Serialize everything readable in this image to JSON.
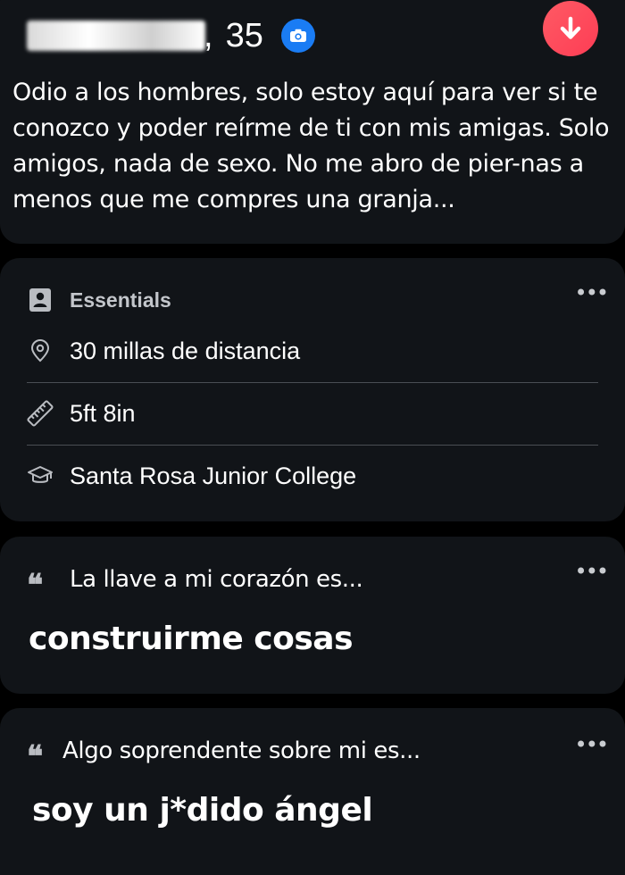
{
  "profile": {
    "name_suffix": ",",
    "age": "35",
    "bio": "Odio a los hombres, solo estoy aquí para ver si te conozco y poder reírme de ti con mis amigas. Solo amigos, nada de sexo. No me abro de pier-nas a menos que me compres una granja..."
  },
  "icons": {
    "verified_badge": "camera-icon",
    "action": "arrow-down-icon",
    "essentials": "id-badge-icon",
    "distance": "location-pin-icon",
    "height": "ruler-icon",
    "school": "graduation-cap-icon",
    "more": "more-dots-icon",
    "quote": "quote-icon"
  },
  "colors": {
    "background": "#000000",
    "card": "#111418",
    "verified_blue": "#1a7cf4",
    "action_red": "#fd3d55",
    "divider": "#4a4e54",
    "muted_text": "#c3c6cb"
  },
  "essentials": {
    "title": "Essentials",
    "more_label": "•••",
    "distance": "30 millas de distancia",
    "height": "5ft 8in",
    "school": "Santa Rosa Junior College"
  },
  "prompts": [
    {
      "quote_mark": "❝",
      "question": "La llave a mi corazón es...",
      "answer": "construirme cosas",
      "more_label": "•••"
    },
    {
      "quote_mark": "❝",
      "question": "Algo soprendente sobre mi es...",
      "answer": "soy un j*dido ángel",
      "more_label": "•••"
    }
  ]
}
